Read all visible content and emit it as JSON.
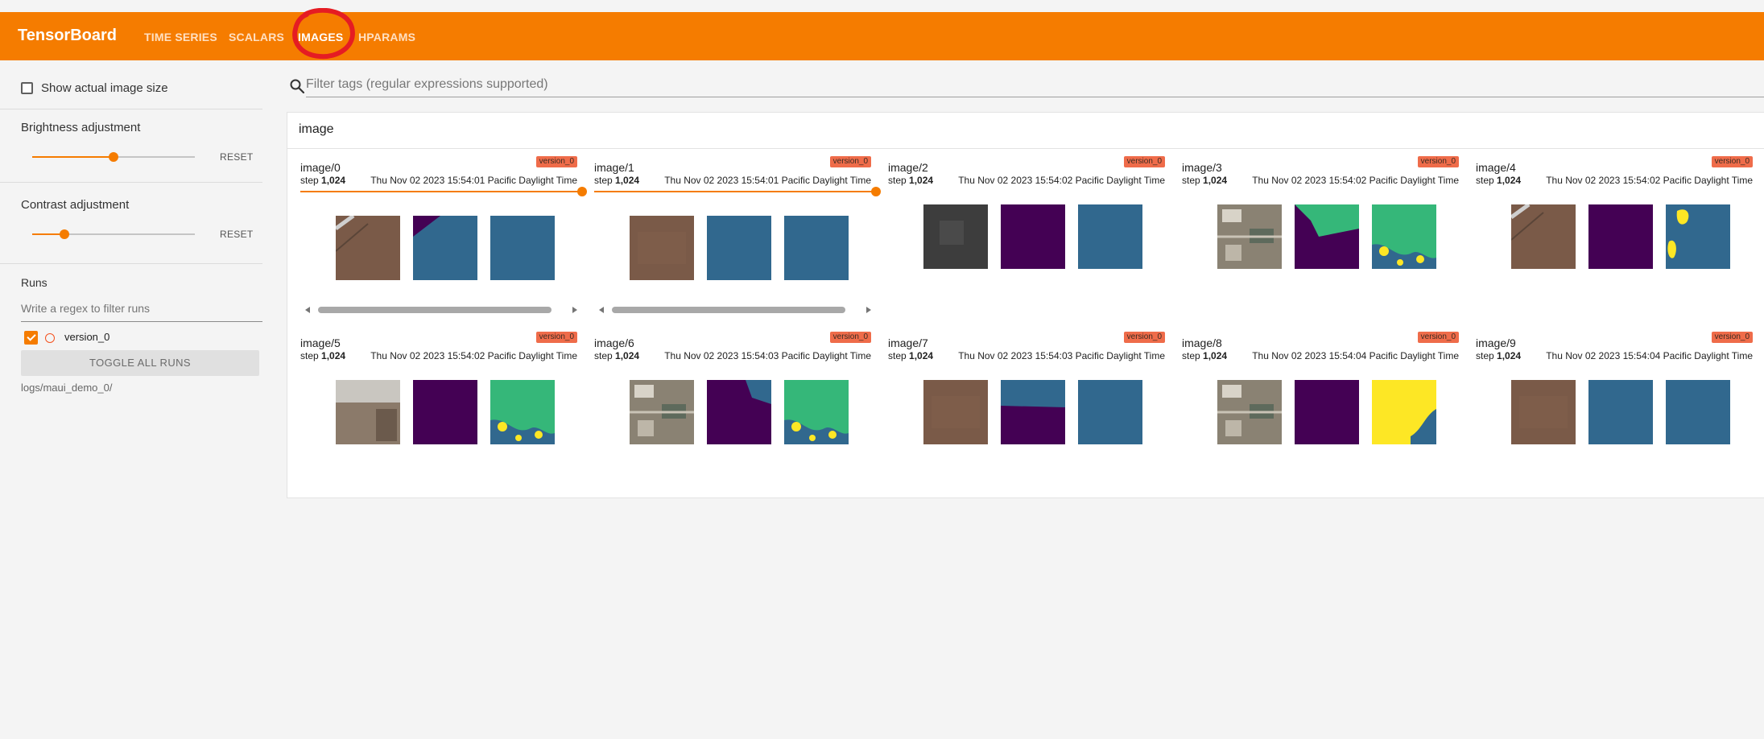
{
  "app": {
    "brand": "TensorBoard",
    "accent": "#f57c00",
    "tabs": [
      {
        "label": "TIME SERIES",
        "active": false
      },
      {
        "label": "SCALARS",
        "active": false
      },
      {
        "label": "IMAGES",
        "active": true
      },
      {
        "label": "HPARAMS",
        "active": false
      }
    ]
  },
  "sidebar": {
    "show_actual_size": {
      "label": "Show actual image size",
      "checked": false
    },
    "brightness": {
      "label": "Brightness adjustment",
      "reset": "RESET",
      "value": 0.5
    },
    "contrast": {
      "label": "Contrast adjustment",
      "reset": "RESET",
      "value": 0.2
    },
    "runs": {
      "title": "Runs",
      "filter_placeholder": "Write a regex to filter runs",
      "items": [
        {
          "name": "version_0",
          "checked": true,
          "color": "#f4511e"
        }
      ],
      "toggle_all": "TOGGLE ALL RUNS",
      "logdir": "logs/maui_demo_0/"
    }
  },
  "main": {
    "filter_placeholder": "Filter tags (regular expressions supported)",
    "group": "image",
    "cards": [
      {
        "tag": "image/0",
        "run": "version_0",
        "step_label": "step",
        "step": "1,024",
        "time": "Thu Nov 02 2023 15:54:01 Pacific Daylight Time",
        "has_step_slider": true,
        "thumbnails": [
          "satellite-brown-road",
          "mask-blue-purple-corner",
          "mask-blue"
        ]
      },
      {
        "tag": "image/1",
        "run": "version_0",
        "step_label": "step",
        "step": "1,024",
        "time": "Thu Nov 02 2023 15:54:01 Pacific Daylight Time",
        "has_step_slider": true,
        "thumbnails": [
          "satellite-brown",
          "mask-blue",
          "mask-blue"
        ]
      },
      {
        "tag": "image/2",
        "run": "version_0",
        "step_label": "step",
        "step": "1,024",
        "time": "Thu Nov 02 2023 15:54:02 Pacific Daylight Time",
        "has_step_slider": false,
        "thumbnails": [
          "satellite-dark-grey",
          "mask-purple",
          "mask-blue"
        ]
      },
      {
        "tag": "image/3",
        "run": "version_0",
        "step_label": "step",
        "step": "1,024",
        "time": "Thu Nov 02 2023 15:54:02 Pacific Daylight Time",
        "has_step_slider": false,
        "thumbnails": [
          "satellite-urban",
          "mask-purple-green",
          "mask-green-yellow"
        ]
      },
      {
        "tag": "image/4",
        "run": "version_0",
        "step_label": "step",
        "step": "1,024",
        "time": "Thu Nov 02 2023 15:54:02 Pacific Daylight Time",
        "has_step_slider": false,
        "thumbnails": [
          "satellite-brown-road",
          "mask-purple",
          "mask-blue-yellow"
        ]
      },
      {
        "tag": "image/5",
        "run": "version_0",
        "step_label": "step",
        "step": "1,024",
        "time": "Thu Nov 02 2023 15:54:02 Pacific Daylight Time",
        "has_step_slider": false,
        "thumbnails": [
          "satellite-building",
          "mask-purple",
          "mask-green-yellow"
        ]
      },
      {
        "tag": "image/6",
        "run": "version_0",
        "step_label": "step",
        "step": "1,024",
        "time": "Thu Nov 02 2023 15:54:03 Pacific Daylight Time",
        "has_step_slider": false,
        "thumbnails": [
          "satellite-urban",
          "mask-purple-blue",
          "mask-green-yellow"
        ]
      },
      {
        "tag": "image/7",
        "run": "version_0",
        "step_label": "step",
        "step": "1,024",
        "time": "Thu Nov 02 2023 15:54:03 Pacific Daylight Time",
        "has_step_slider": false,
        "thumbnails": [
          "satellite-brown",
          "mask-blue-purple-split",
          "mask-blue"
        ]
      },
      {
        "tag": "image/8",
        "run": "version_0",
        "step_label": "step",
        "step": "1,024",
        "time": "Thu Nov 02 2023 15:54:04 Pacific Daylight Time",
        "has_step_slider": false,
        "thumbnails": [
          "satellite-urban",
          "mask-purple",
          "mask-yellow-blue"
        ]
      },
      {
        "tag": "image/9",
        "run": "version_0",
        "step_label": "step",
        "step": "1,024",
        "time": "Thu Nov 02 2023 15:54:04 Pacific Daylight Time",
        "has_step_slider": false,
        "thumbnails": [
          "satellite-brown",
          "mask-blue",
          "mask-blue"
        ]
      }
    ]
  },
  "colors": {
    "mask_blue": "#31688e",
    "mask_purple": "#440154",
    "mask_green": "#35b779",
    "mask_yellow": "#fde725",
    "satellite_brown": "#7a5a48",
    "badge": "#ef6c4a"
  }
}
